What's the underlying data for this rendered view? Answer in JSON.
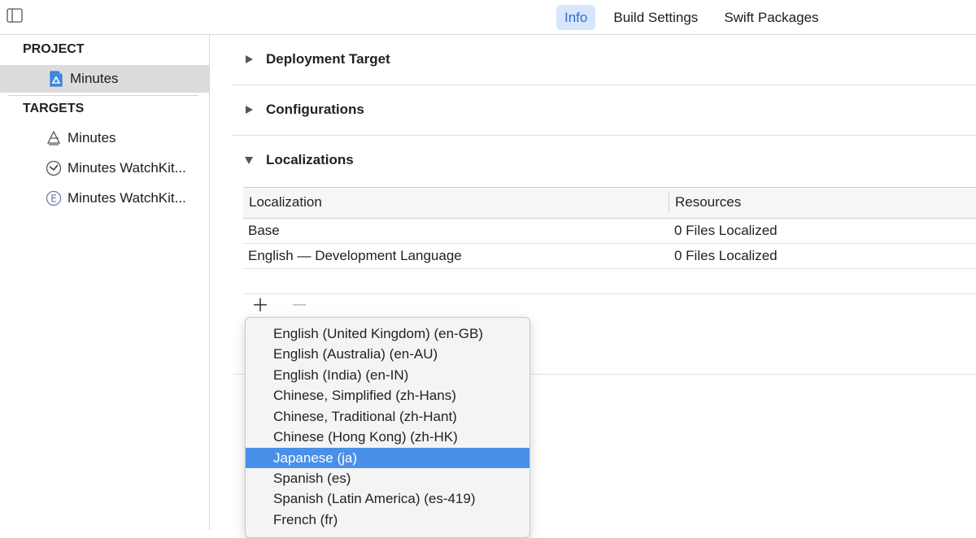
{
  "toolbar": {
    "tabs": [
      "Info",
      "Build Settings",
      "Swift Packages"
    ],
    "active_tab": "Info"
  },
  "sidebar": {
    "project_header": "PROJECT",
    "project_item": "Minutes",
    "targets_header": "TARGETS",
    "targets": [
      {
        "label": "Minutes",
        "icon": "app-target-icon"
      },
      {
        "label": "Minutes WatchKit...",
        "icon": "watch-app-icon"
      },
      {
        "label": "Minutes WatchKit...",
        "icon": "watch-extension-icon"
      }
    ]
  },
  "main": {
    "sections": [
      {
        "title": "Deployment Target",
        "expanded": false
      },
      {
        "title": "Configurations",
        "expanded": false
      },
      {
        "title": "Localizations",
        "expanded": true
      }
    ],
    "table": {
      "columns": [
        "Localization",
        "Resources"
      ],
      "rows": [
        [
          "Base",
          "0 Files Localized"
        ],
        [
          "English — Development Language",
          "0 Files Localized"
        ]
      ]
    },
    "add_label": "+",
    "remove_label": "—"
  },
  "dropdown": {
    "items": [
      "English (United Kingdom) (en-GB)",
      "English (Australia) (en-AU)",
      "English (India) (en-IN)",
      "Chinese, Simplified (zh-Hans)",
      "Chinese, Traditional (zh-Hant)",
      "Chinese (Hong Kong) (zh-HK)",
      "Japanese (ja)",
      "Spanish (es)",
      "Spanish (Latin America) (es-419)",
      "French (fr)"
    ],
    "highlighted": "Japanese (ja)"
  },
  "colors": {
    "accent": "#2a6fd6",
    "highlight": "#4a90e8",
    "tab_active_bg": "#d7e6fb"
  }
}
